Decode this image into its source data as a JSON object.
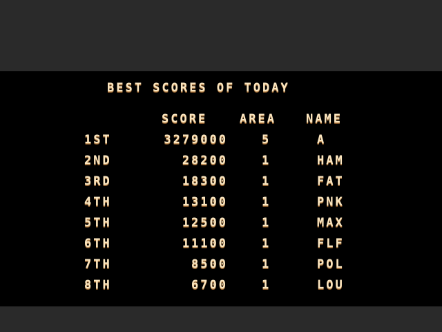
{
  "title": "BEST SCORES OF TODAY",
  "headers": {
    "score": "SCORE",
    "area": "AREA",
    "name": "NAME"
  },
  "rows": [
    {
      "rank": "1ST",
      "score": "3279000",
      "area": "5",
      "name": "A"
    },
    {
      "rank": "2ND",
      "score": "28200",
      "area": "1",
      "name": "HAM"
    },
    {
      "rank": "3RD",
      "score": "18300",
      "area": "1",
      "name": "FAT"
    },
    {
      "rank": "4TH",
      "score": "13100",
      "area": "1",
      "name": "PNK"
    },
    {
      "rank": "5TH",
      "score": "12500",
      "area": "1",
      "name": "MAX"
    },
    {
      "rank": "6TH",
      "score": "11100",
      "area": "1",
      "name": "FLF"
    },
    {
      "rank": "7TH",
      "score": "8500",
      "area": "1",
      "name": "POL"
    },
    {
      "rank": "8TH",
      "score": "6700",
      "area": "1",
      "name": "LOU"
    }
  ],
  "colors": {
    "text": "#fbe6c0",
    "background": "#000000",
    "letterbox": "#2a2a2a"
  }
}
